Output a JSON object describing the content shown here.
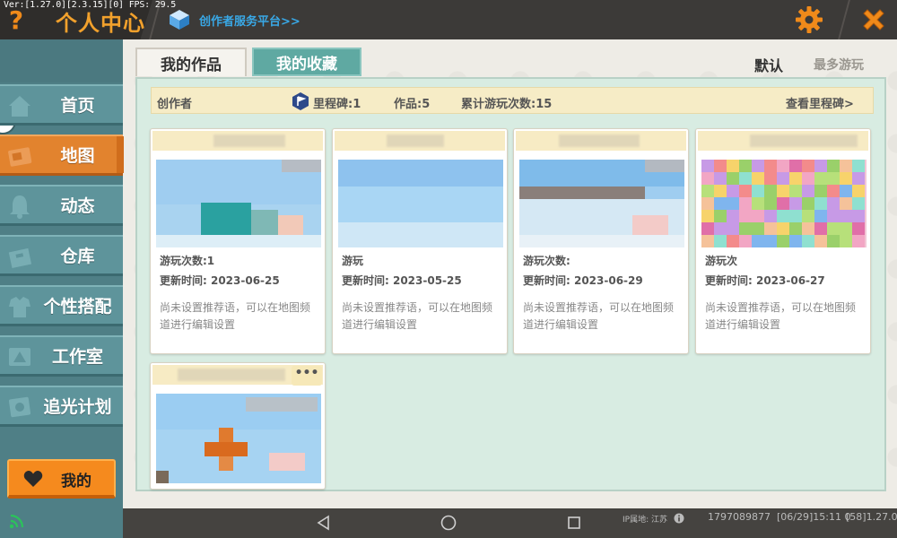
{
  "debug": {
    "version_text": "Ver:[1.27.0][2.3.15][0] FPS: 29.5"
  },
  "header": {
    "title": "个人中心",
    "creator_platform": "创作者服务平台>>",
    "help_icon": "question-icon",
    "settings_icon": "gear-icon",
    "close_icon": "close-icon"
  },
  "sidebar": {
    "items": [
      {
        "label": "首页",
        "icon": "home-icon",
        "active": false
      },
      {
        "label": "地图",
        "icon": "map-icon",
        "active": true
      },
      {
        "label": "动态",
        "icon": "bell-icon",
        "active": false
      },
      {
        "label": "仓库",
        "icon": "box-icon",
        "active": false
      },
      {
        "label": "个性搭配",
        "icon": "outfit-icon",
        "active": false
      },
      {
        "label": "工作室",
        "icon": "studio-icon",
        "active": false
      },
      {
        "label": "追光计划",
        "icon": "light-icon",
        "active": false
      }
    ],
    "mine_button": "我的"
  },
  "tabs": [
    {
      "label": "我的作品",
      "active": true
    },
    {
      "label": "我的收藏",
      "active": false
    }
  ],
  "sort": {
    "default_label": "默认",
    "most_played_label": "最多游玩"
  },
  "info_bar": {
    "creator_label": "创作者",
    "milestone": "里程碑:1",
    "works": "作品:5",
    "total_plays": "累计游玩次数:15",
    "view_milestone": "查看里程碑>"
  },
  "cards": [
    {
      "plays": "游玩次数:1",
      "updated": "更新时间: 2023-06-25",
      "desc": "尚未设置推荐语，可以在地图频道进行编辑设置"
    },
    {
      "plays": "游玩",
      "updated": "更新时间: 2023-05-25",
      "desc": "尚未设置推荐语，可以在地图频道进行编辑设置"
    },
    {
      "plays": "游玩次数:",
      "updated": "更新时间: 2023-06-29",
      "desc": "尚未设置推荐语，可以在地图频道进行编辑设置"
    },
    {
      "plays": "游玩次",
      "updated": "更新时间: 2023-06-27",
      "desc": "尚未设置推荐语，可以在地图频道进行编辑设置"
    },
    {
      "more_label": "•••"
    }
  ],
  "status_bar": {
    "ip_location": "IP属地: 江苏",
    "uid": "1797089877",
    "datetime": "[06/29]15:11 0",
    "version": "[58]1.27.0"
  },
  "colors": {
    "accent_orange": "#e2832e",
    "sidebar_teal": "#5e949b",
    "panel_green": "#d8ece2",
    "title_gold": "#f2a12c"
  }
}
